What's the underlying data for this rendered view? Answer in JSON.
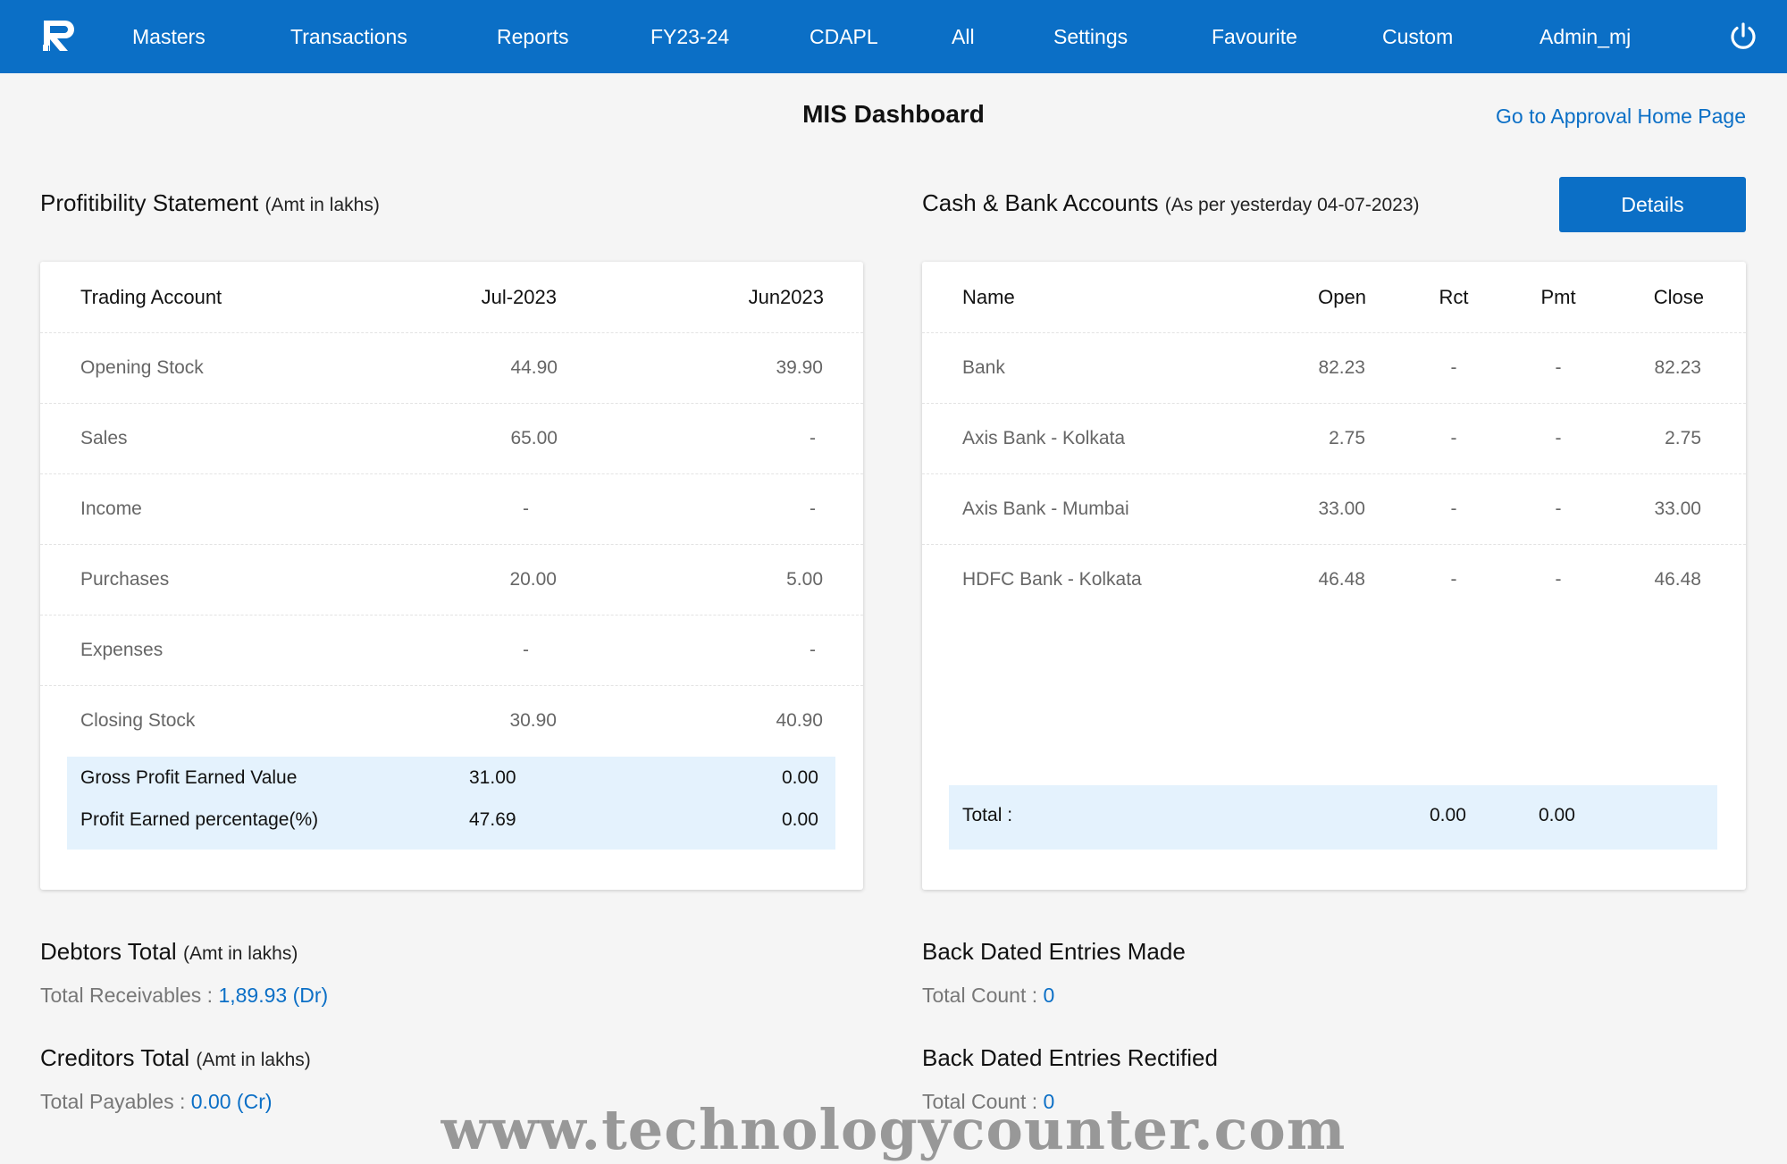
{
  "nav": {
    "items": [
      "Masters",
      "Transactions",
      "Reports",
      "FY23-24",
      "CDAPL",
      "All",
      "Settings",
      "Favourite",
      "Custom",
      "Admin_mj"
    ]
  },
  "page": {
    "title": "MIS Dashboard",
    "approval_link": "Go to Approval Home Page"
  },
  "profitability": {
    "heading": "Profitibility Statement",
    "note": "(Amt in lakhs)",
    "columns": [
      "Trading Account",
      "Jul-2023",
      "Jun2023"
    ],
    "rows": [
      [
        "Opening Stock",
        "44.90",
        "39.90"
      ],
      [
        "Sales",
        "65.00",
        "-"
      ],
      [
        "Income",
        "-",
        "-"
      ],
      [
        "Purchases",
        "20.00",
        "5.00"
      ],
      [
        "Expenses",
        "-",
        "-"
      ],
      [
        "Closing Stock",
        "30.90",
        "40.90"
      ]
    ],
    "summary": [
      [
        "Gross Profit Earned Value",
        "31.00",
        "0.00"
      ],
      [
        "Profit Earned percentage(%)",
        "47.69",
        "0.00"
      ]
    ]
  },
  "cash_bank": {
    "heading": "Cash & Bank Accounts",
    "note": "(As per yesterday 04-07-2023)",
    "details_label": "Details",
    "columns": [
      "Name",
      "Open",
      "Rct",
      "Pmt",
      "Close"
    ],
    "rows": [
      [
        "Bank",
        "82.23",
        "-",
        "-",
        "82.23"
      ],
      [
        "Axis Bank - Kolkata",
        "2.75",
        "-",
        "-",
        "2.75"
      ],
      [
        "Axis Bank - Mumbai",
        "33.00",
        "-",
        "-",
        "33.00"
      ],
      [
        "HDFC Bank - Kolkata",
        "46.48",
        "-",
        "-",
        "46.48"
      ]
    ],
    "total": {
      "label": "Total :",
      "rct": "0.00",
      "pmt": "0.00"
    }
  },
  "debtors": {
    "heading": "Debtors Total",
    "note": "(Amt in lakhs)",
    "label": "Total Receivables : ",
    "value": "1,89.93 (Dr)"
  },
  "creditors": {
    "heading": "Creditors Total",
    "note": "(Amt in lakhs)",
    "label": "Total Payables : ",
    "value": "0.00 (Cr)"
  },
  "back_dated_made": {
    "heading": "Back Dated Entries Made",
    "label": "Total Count : ",
    "value": "0"
  },
  "back_dated_rectified": {
    "heading": "Back Dated Entries Rectified",
    "label": "Total Count : ",
    "value": "0"
  },
  "watermark": "www.technologycounter.com",
  "colors": {
    "primary": "#0b6fc6",
    "summary_bg": "#e4f2fd",
    "page_bg": "#f5f5f5"
  },
  "icons": {
    "logo": "app-logo-icon",
    "power": "power-icon"
  }
}
